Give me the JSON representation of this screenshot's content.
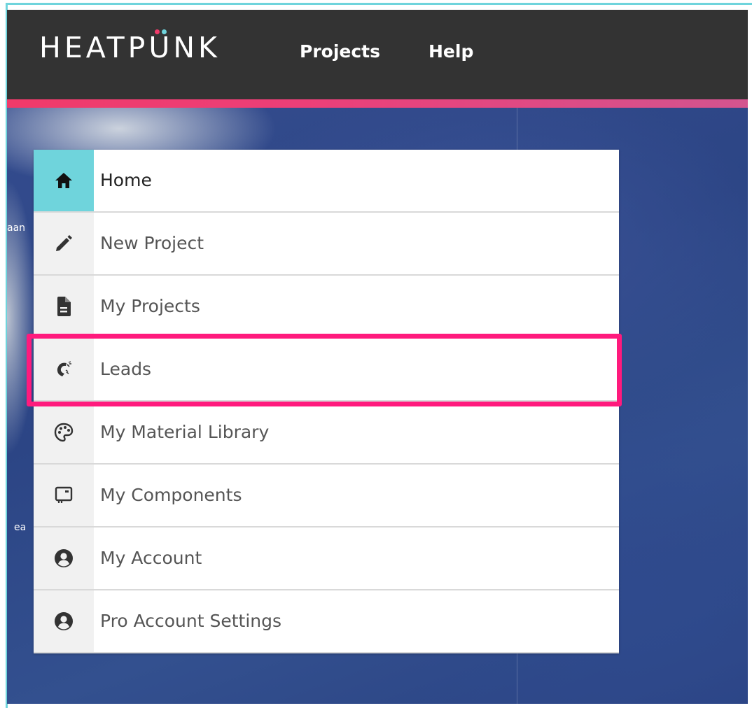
{
  "app": {
    "logo_text_before": "HEATP",
    "logo_text_u": "U",
    "logo_text_after": "NK",
    "logo_dot_colors": [
      "#f03a6a",
      "#6fd4dc"
    ]
  },
  "header": {
    "nav": [
      {
        "label": "Projects"
      },
      {
        "label": "Help"
      }
    ]
  },
  "map": {
    "labels": [
      "aan",
      "ea"
    ]
  },
  "menu": {
    "items": [
      {
        "label": "Home",
        "icon": "home-icon",
        "active": true
      },
      {
        "label": "New Project",
        "icon": "pencil-icon",
        "active": false
      },
      {
        "label": "My Projects",
        "icon": "document-icon",
        "active": false
      },
      {
        "label": "Leads",
        "icon": "magnet-icon",
        "active": false,
        "highlighted": true
      },
      {
        "label": "My Material Library",
        "icon": "palette-icon",
        "active": false
      },
      {
        "label": "My Components",
        "icon": "boiler-icon",
        "active": false
      },
      {
        "label": "My Account",
        "icon": "user-circle-icon",
        "active": false
      },
      {
        "label": "Pro Account Settings",
        "icon": "user-circle-icon",
        "active": false
      }
    ]
  },
  "colors": {
    "navbar_bg": "#333333",
    "accent_pink": "#f03a6a",
    "accent_cyan": "#6fd4dc",
    "highlight_border": "#ff1a7d"
  }
}
